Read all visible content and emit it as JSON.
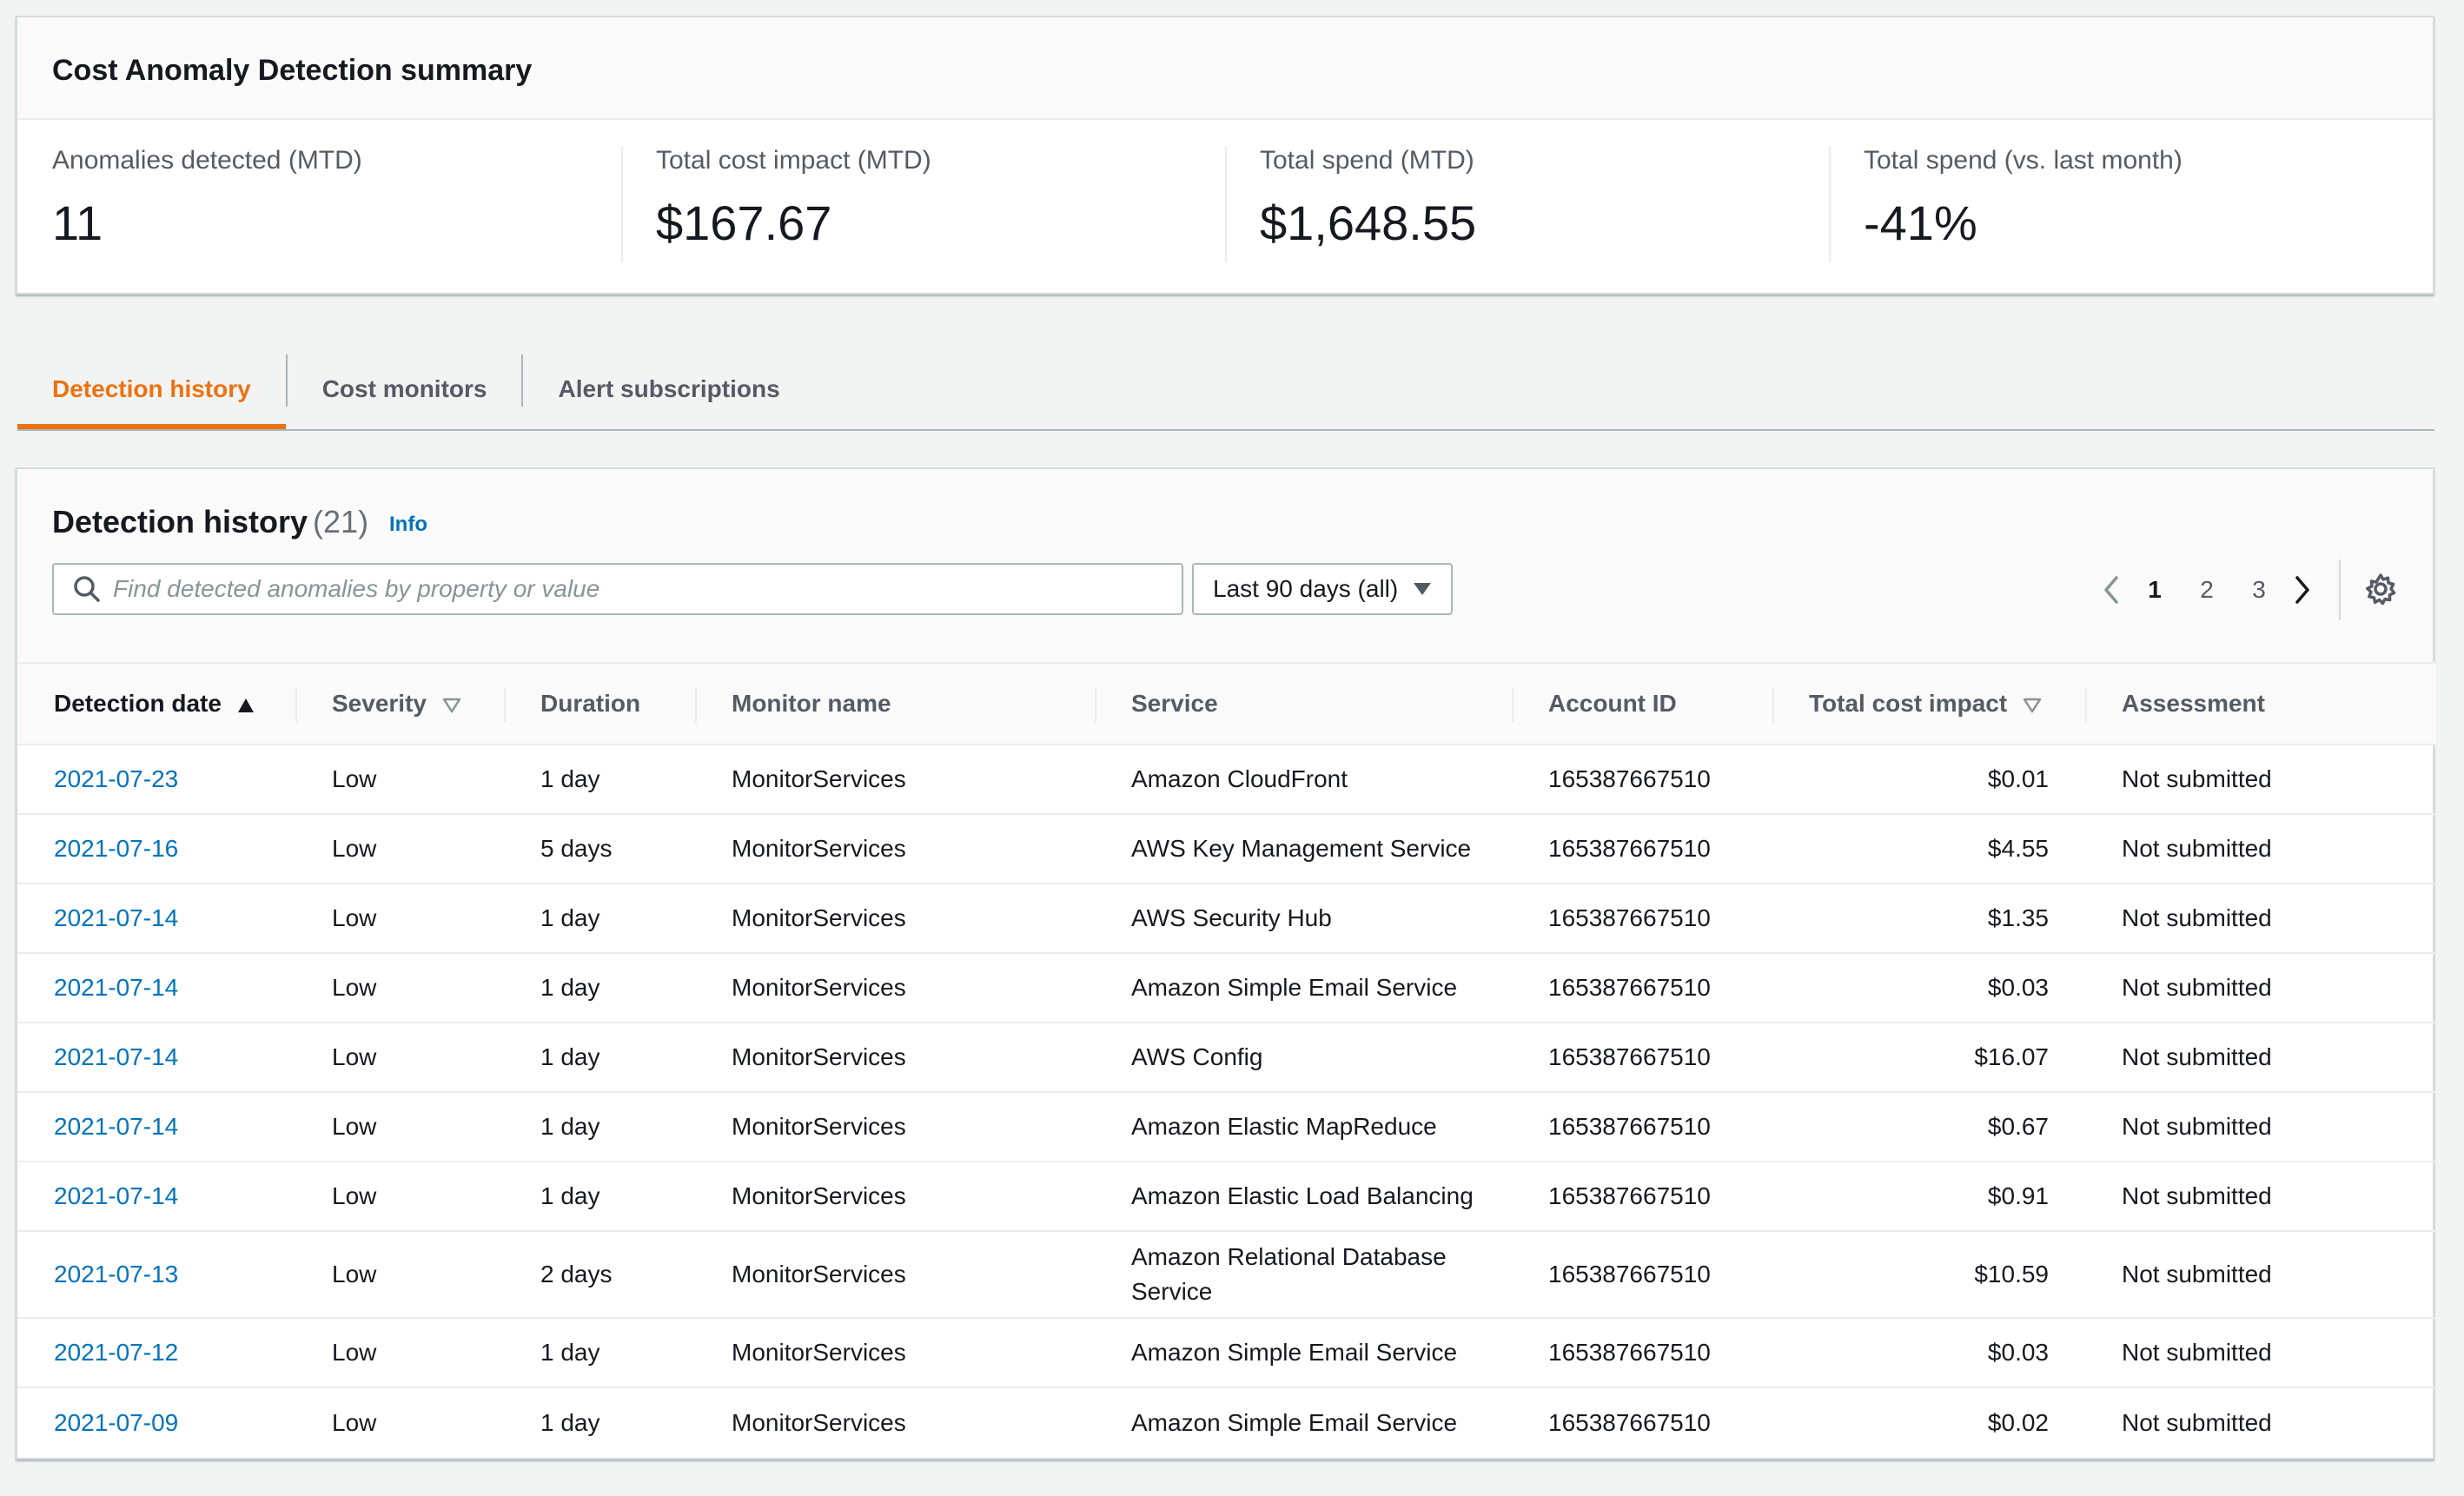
{
  "summary": {
    "title": "Cost Anomaly Detection summary",
    "metrics": [
      {
        "label": "Anomalies detected (MTD)",
        "value": "11"
      },
      {
        "label": "Total cost impact (MTD)",
        "value": "$167.67"
      },
      {
        "label": "Total spend (MTD)",
        "value": "$1,648.55"
      },
      {
        "label": "Total spend (vs. last month)",
        "value": "-41%"
      }
    ]
  },
  "tabs": [
    {
      "label": "Detection history",
      "active": true
    },
    {
      "label": "Cost monitors",
      "active": false
    },
    {
      "label": "Alert subscriptions",
      "active": false
    }
  ],
  "history": {
    "title": "Detection history",
    "count": "(21)",
    "info": "Info",
    "search_placeholder": "Find detected anomalies by property or value",
    "range": "Last 90 days (all)",
    "pages": [
      "1",
      "2",
      "3"
    ],
    "current_page": "1",
    "columns": [
      "Detection date",
      "Severity",
      "Duration",
      "Monitor name",
      "Service",
      "Account ID",
      "Total cost impact",
      "Assessment"
    ],
    "rows": [
      [
        "2021-07-23",
        "Low",
        "1 day",
        "MonitorServices",
        "Amazon CloudFront",
        "165387667510",
        "$0.01",
        "Not submitted"
      ],
      [
        "2021-07-16",
        "Low",
        "5 days",
        "MonitorServices",
        "AWS Key Management Service",
        "165387667510",
        "$4.55",
        "Not submitted"
      ],
      [
        "2021-07-14",
        "Low",
        "1 day",
        "MonitorServices",
        "AWS Security Hub",
        "165387667510",
        "$1.35",
        "Not submitted"
      ],
      [
        "2021-07-14",
        "Low",
        "1 day",
        "MonitorServices",
        "Amazon Simple Email Service",
        "165387667510",
        "$0.03",
        "Not submitted"
      ],
      [
        "2021-07-14",
        "Low",
        "1 day",
        "MonitorServices",
        "AWS Config",
        "165387667510",
        "$16.07",
        "Not submitted"
      ],
      [
        "2021-07-14",
        "Low",
        "1 day",
        "MonitorServices",
        "Amazon Elastic MapReduce",
        "165387667510",
        "$0.67",
        "Not submitted"
      ],
      [
        "2021-07-14",
        "Low",
        "1 day",
        "MonitorServices",
        "Amazon Elastic Load Balancing",
        "165387667510",
        "$0.91",
        "Not submitted"
      ],
      [
        "2021-07-13",
        "Low",
        "2 days",
        "MonitorServices",
        "Amazon Relational Database Service",
        "165387667510",
        "$10.59",
        "Not submitted"
      ],
      [
        "2021-07-12",
        "Low",
        "1 day",
        "MonitorServices",
        "Amazon Simple Email Service",
        "165387667510",
        "$0.03",
        "Not submitted"
      ],
      [
        "2021-07-09",
        "Low",
        "1 day",
        "MonitorServices",
        "Amazon Simple Email Service",
        "165387667510",
        "$0.02",
        "Not submitted"
      ]
    ]
  },
  "colors": {
    "accent": "#ec7211",
    "link": "#0073bb",
    "text": "#16191f",
    "muted": "#545b64",
    "background": "#f2f3f3"
  },
  "icons": [
    "search-icon",
    "caret-down-icon",
    "chevron-left-icon",
    "chevron-right-icon",
    "gear-icon",
    "sort-ascending-icon",
    "sort-descending-icon"
  ]
}
